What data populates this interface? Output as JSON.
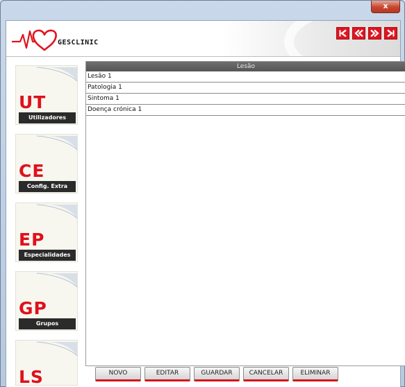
{
  "window": {
    "close_glyph": "x"
  },
  "header": {
    "brand": "GESCLINIC",
    "nav": [
      {
        "icon": "first-icon"
      },
      {
        "icon": "prev-icon"
      },
      {
        "icon": "next-icon"
      },
      {
        "icon": "last-icon"
      }
    ],
    "accent": "#e0141f"
  },
  "sidebar": {
    "items": [
      {
        "code": "UT",
        "label": "Utilizadores"
      },
      {
        "code": "CE",
        "label": "Config. Extra"
      },
      {
        "code": "EP",
        "label": "Especialidades"
      },
      {
        "code": "GP",
        "label": "Grupos"
      },
      {
        "code": "LS",
        "label": ""
      }
    ]
  },
  "grid": {
    "column": "Lesão",
    "rows": [
      "Lesão 1",
      "Patologia 1",
      "Sintoma 1",
      "Doença crónica 1"
    ]
  },
  "actions": {
    "novo": "NOVO",
    "editar": "EDITAR",
    "guardar": "GUARDAR",
    "cancelar": "CANCELAR",
    "eliminar": "ELIMINAR"
  }
}
